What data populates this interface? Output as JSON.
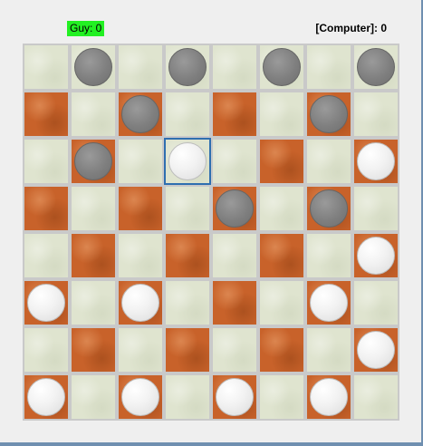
{
  "scores": {
    "player": "Guy: 0",
    "computer": "[Computer]: 0"
  },
  "board": {
    "rows": [
      [
        "light",
        "light",
        "light",
        "light",
        "light",
        "light",
        "light",
        "light"
      ],
      [
        "dark",
        "light",
        "dark",
        "light",
        "dark",
        "light",
        "dark",
        "light"
      ],
      [
        "light",
        "dark",
        "light",
        "light",
        "light",
        "dark",
        "light",
        "dark"
      ],
      [
        "dark",
        "light",
        "dark",
        "light",
        "dark",
        "light",
        "dark",
        "light"
      ],
      [
        "light",
        "dark",
        "light",
        "dark",
        "light",
        "dark",
        "light",
        "dark"
      ],
      [
        "dark",
        "light",
        "dark",
        "light",
        "dark",
        "light",
        "dark",
        "light"
      ],
      [
        "light",
        "dark",
        "light",
        "dark",
        "light",
        "dark",
        "light",
        "dark"
      ],
      [
        "dark",
        "light",
        "dark",
        "light",
        "dark",
        "light",
        "dark",
        "light"
      ]
    ],
    "pieces": [
      [
        "",
        "gray",
        "",
        "gray",
        "",
        "gray",
        "",
        "gray"
      ],
      [
        "",
        "",
        "gray",
        "",
        "",
        "",
        "gray",
        ""
      ],
      [
        "",
        "gray",
        "",
        "white",
        "",
        "",
        "",
        "white"
      ],
      [
        "",
        "",
        "",
        "",
        "gray",
        "",
        "gray",
        ""
      ],
      [
        "",
        "",
        "",
        "",
        "",
        "",
        "",
        "white"
      ],
      [
        "white",
        "",
        "white",
        "",
        "",
        "",
        "white",
        ""
      ],
      [
        "",
        "",
        "",
        "",
        "",
        "",
        "",
        "white"
      ],
      [
        "white",
        "",
        "white",
        "",
        "white",
        "",
        "white",
        ""
      ]
    ],
    "selected": {
      "row": 2,
      "col": 3
    }
  },
  "colors": {
    "player_badge": "#22f022",
    "selected_outline": "#2f6fb0"
  }
}
